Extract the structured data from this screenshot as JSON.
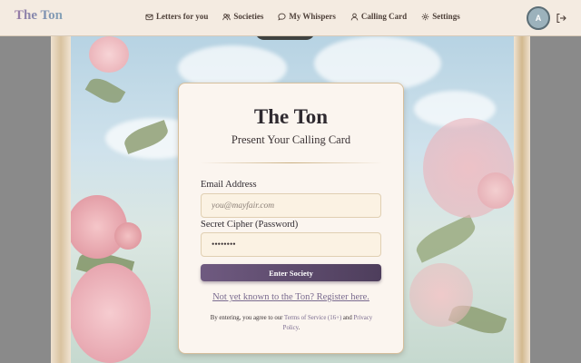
{
  "brand": "The Ton",
  "nav": {
    "items": [
      {
        "label": "Letters for you",
        "icon": "envelope-icon"
      },
      {
        "label": "Societies",
        "icon": "users-icon"
      },
      {
        "label": "My Whispers",
        "icon": "chat-bubble-icon"
      },
      {
        "label": "Calling Card",
        "icon": "user-icon"
      },
      {
        "label": "Settings",
        "icon": "gear-icon"
      }
    ],
    "avatar_initial": "A",
    "logout_icon": "logout-icon"
  },
  "login": {
    "title": "The Ton",
    "subtitle": "Present Your Calling Card",
    "email_label": "Email Address",
    "email_placeholder": "you@mayfair.com",
    "password_label": "Secret Cipher (Password)",
    "password_value": "••••••••",
    "submit_label": "Enter Society",
    "register_link": "Not yet known to the Ton? Register here.",
    "legal_prefix": "By entering, you agree to our",
    "terms_link": "Terms of Service (16+)",
    "legal_and": "and",
    "privacy_link": "Privacy Policy",
    "legal_suffix": "."
  },
  "colors": {
    "accent": "#5e4a6e",
    "nav_bg": "#f4ebe1",
    "card_bg": "#fbf5ef"
  }
}
